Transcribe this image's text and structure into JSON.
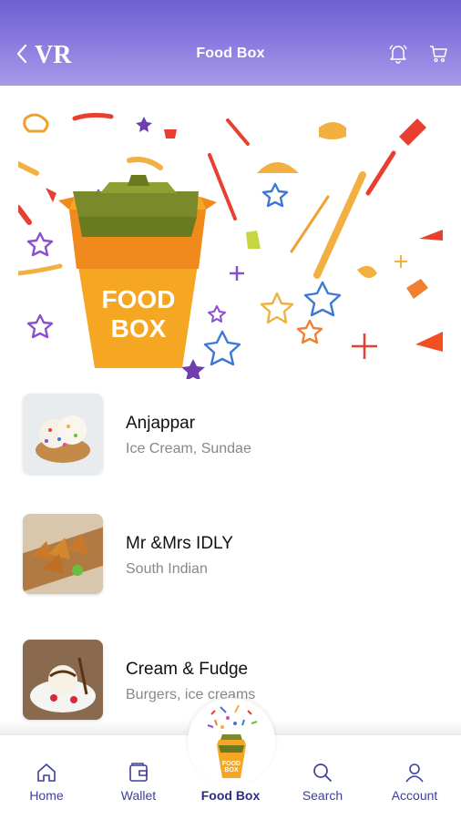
{
  "header": {
    "title": "Food Box",
    "back_icon": "chevron-left-icon",
    "logo_text": "VR",
    "bell_icon": "bell-icon",
    "cart_icon": "cart-icon",
    "gradient_top": "#6f5fd0",
    "gradient_bottom": "#a79be8"
  },
  "banner": {
    "box_text_line1": "FOOD",
    "box_text_line2": "BOX"
  },
  "restaurants": [
    {
      "name": "Anjappar",
      "cuisine": "Ice Cream, Sundae"
    },
    {
      "name": "Mr &Mrs IDLY",
      "cuisine": "South Indian"
    },
    {
      "name": "Cream & Fudge",
      "cuisine": "Burgers, ice creams"
    }
  ],
  "bottom_nav": {
    "items": [
      {
        "label": "Home",
        "icon": "home-icon"
      },
      {
        "label": "Wallet",
        "icon": "wallet-icon"
      },
      {
        "label": "Food Box",
        "icon": "food-box-icon",
        "active": true
      },
      {
        "label": "Search",
        "icon": "search-icon"
      },
      {
        "label": "Account",
        "icon": "account-icon"
      }
    ],
    "accent": "#3d3f9e"
  }
}
